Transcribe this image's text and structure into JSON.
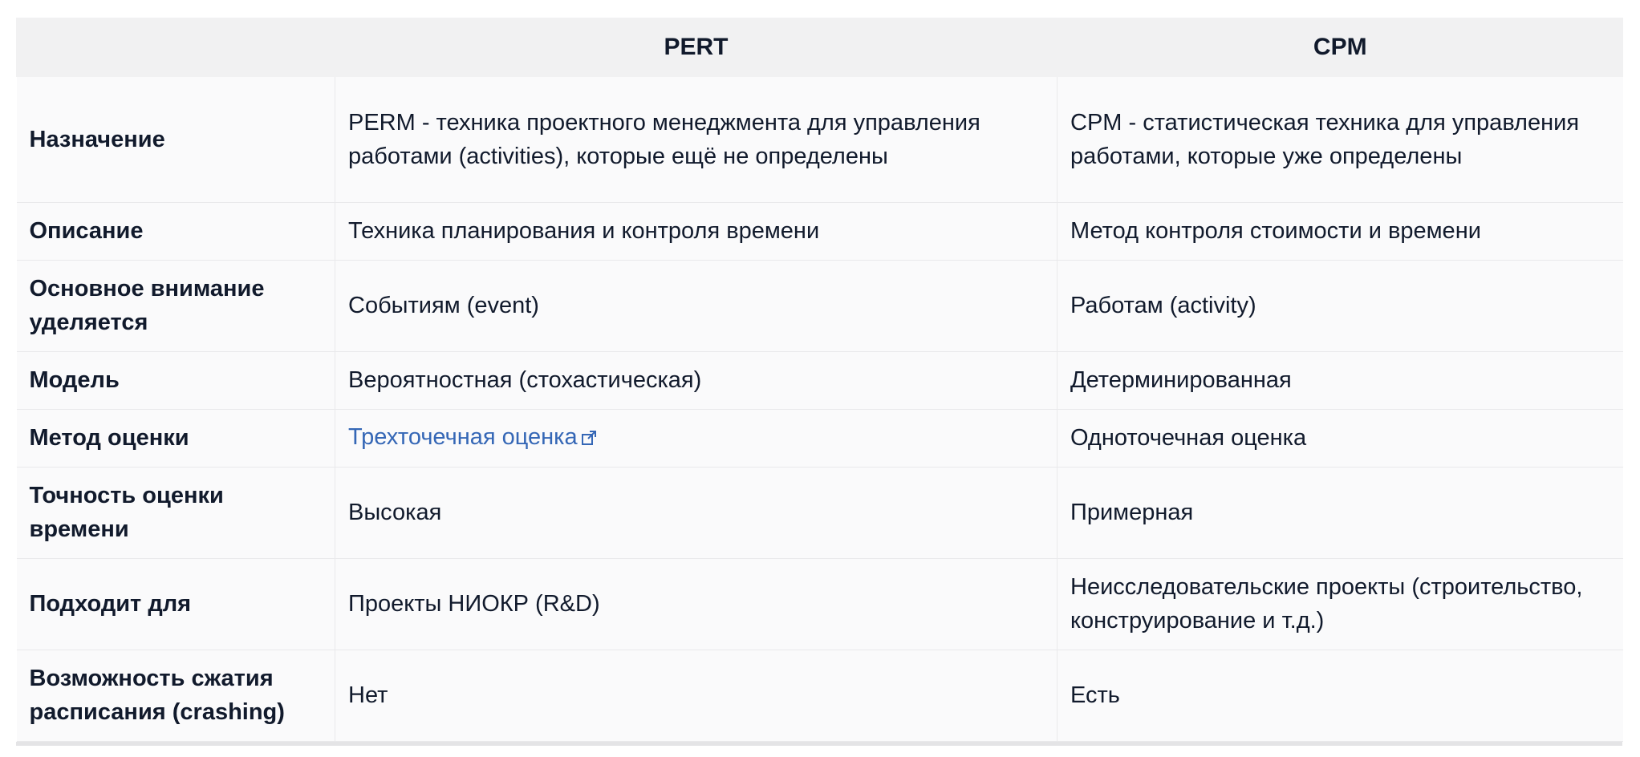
{
  "table": {
    "headers": [
      "",
      "PERT",
      "CPM"
    ],
    "rows": [
      {
        "label": "Назначение",
        "pert": "PERM - техника проектного менеджмента для управления работами (activities), которые ещё не определены",
        "cpm": "CPM - статистическая техника для управления работами, которые уже определены"
      },
      {
        "label": "Описание",
        "pert": "Техника планирования и контроля времени",
        "cpm": "Метод контроля стоимости и времени"
      },
      {
        "label": "Основное внимание уделяется",
        "pert": "Событиям (event)",
        "cpm": "Работам (activity)"
      },
      {
        "label": "Модель",
        "pert": "Вероятностная (стохастическая)",
        "cpm": "Детерминированная"
      },
      {
        "label": "Метод оценки",
        "pert": "Трехточечная оценка",
        "cpm": "Одноточечная оценка"
      },
      {
        "label": "Точность оценки времени",
        "pert": "Высокая",
        "cpm": "Примерная"
      },
      {
        "label": "Подходит для",
        "pert": "Проекты НИОКР (R&D)",
        "cpm": "Неисследовательские проекты (строительство, конструирование и т.д.)"
      },
      {
        "label": "Возможность сжатия расписания (crashing)",
        "pert": "Нет",
        "cpm": "Есть"
      }
    ]
  },
  "icons": {
    "external_link": "external-link-icon"
  },
  "colors": {
    "link": "#3567b6",
    "header_bg": "#f1f1f2",
    "cell_bg": "#fafafb",
    "text": "#111a2c"
  }
}
